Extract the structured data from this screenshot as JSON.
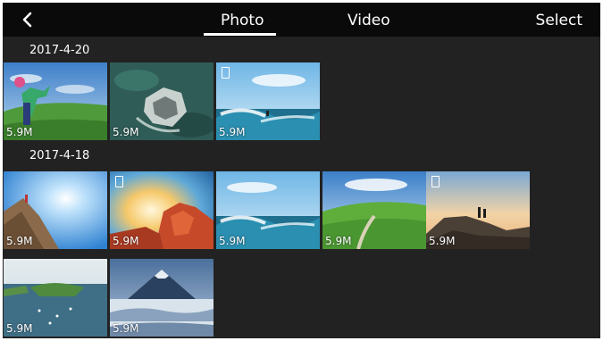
{
  "header": {
    "tabs": [
      {
        "label": "Photo",
        "active": true
      },
      {
        "label": "Video",
        "active": false
      }
    ],
    "select_label": "Select",
    "back_icon": "chevron-left-icon"
  },
  "groups": [
    {
      "date": "2017-4-20",
      "items": [
        {
          "size": "5.9M",
          "scene": "person-on-hill"
        },
        {
          "size": "5.9M",
          "scene": "aerial-rock-sea"
        },
        {
          "size": "5.9M",
          "scene": "surf-wave",
          "video": true
        }
      ]
    },
    {
      "date": "2017-4-18",
      "items": [
        {
          "size": "5.9M",
          "scene": "climber-sun"
        },
        {
          "size": "5.9M",
          "scene": "red-cliffs-sky",
          "video": true
        },
        {
          "size": "5.9M",
          "scene": "surf-wave"
        },
        {
          "size": "5.9M",
          "scene": "green-hills-road"
        },
        {
          "size": "5.9M",
          "scene": "rock-sunset",
          "video": true
        },
        {
          "size": "5.9M",
          "scene": "bay-boats"
        },
        {
          "size": "5.9M",
          "scene": "mountain-fog"
        }
      ]
    }
  ],
  "colors": {
    "background": "#222222",
    "topbar": "#0a0a0a",
    "text": "#ffffff"
  }
}
